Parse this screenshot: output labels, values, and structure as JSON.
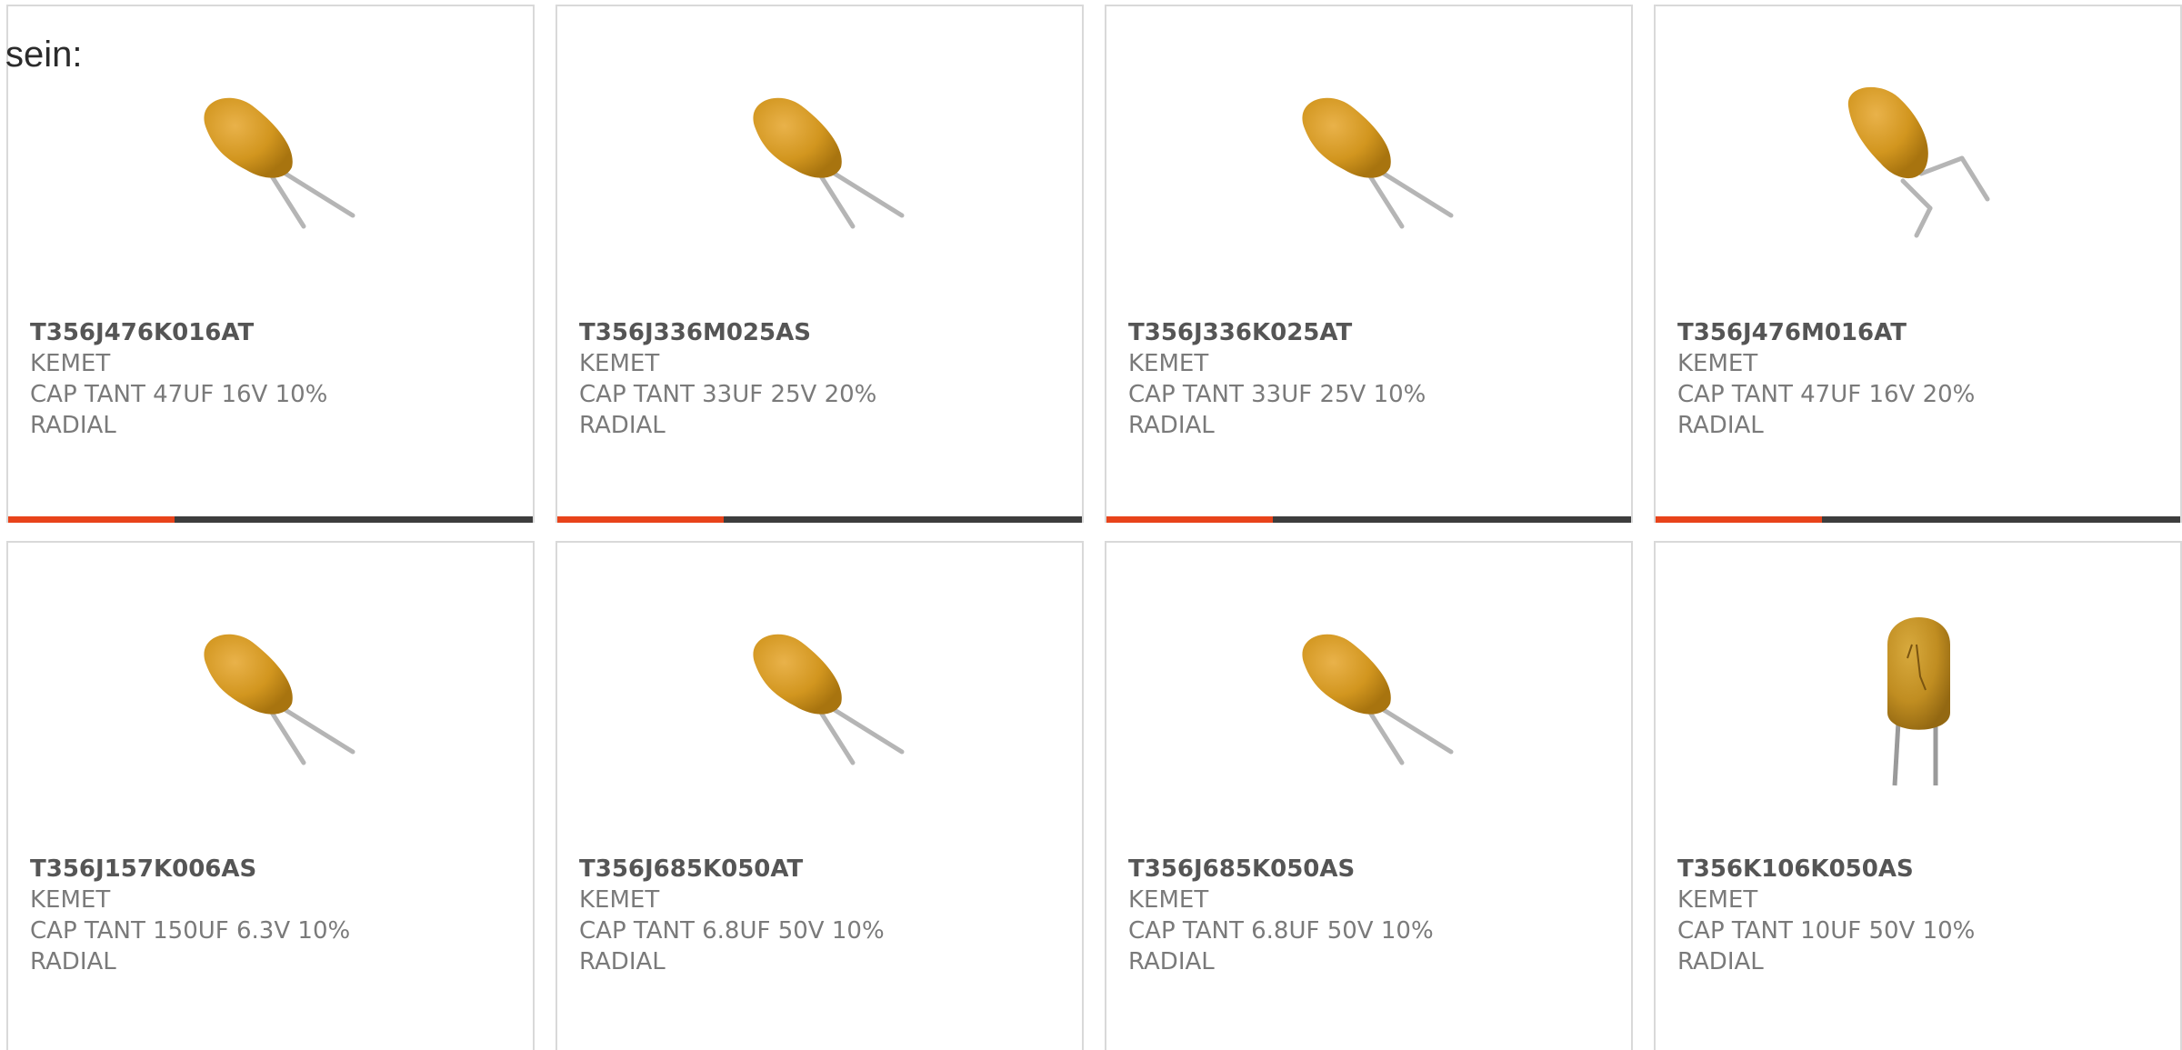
{
  "lead_text": "sein:",
  "accent_color": "#e8431a",
  "bar_color": "#3d3d3d",
  "products": [
    {
      "part": "T356J476K016AT",
      "maker": "KEMET",
      "desc1": "CAP TANT 47UF 16V 10%",
      "desc2": "RADIAL",
      "image": "radial-tantalum-capacitor-tilted"
    },
    {
      "part": "T356J336M025AS",
      "maker": "KEMET",
      "desc1": "CAP TANT 33UF 25V 20%",
      "desc2": "RADIAL",
      "image": "radial-tantalum-capacitor-tilted"
    },
    {
      "part": "T356J336K025AT",
      "maker": "KEMET",
      "desc1": "CAP TANT 33UF 25V 10%",
      "desc2": "RADIAL",
      "image": "radial-tantalum-capacitor-tilted"
    },
    {
      "part": "T356J476M016AT",
      "maker": "KEMET",
      "desc1": "CAP TANT 47UF 16V 20%",
      "desc2": "RADIAL",
      "image": "radial-tantalum-capacitor-angled"
    },
    {
      "part": "T356J157K006AS",
      "maker": "KEMET",
      "desc1": "CAP TANT 150UF 6.3V 10%",
      "desc2": "RADIAL",
      "image": "radial-tantalum-capacitor-tilted"
    },
    {
      "part": "T356J685K050AT",
      "maker": "KEMET",
      "desc1": "CAP TANT 6.8UF 50V 10%",
      "desc2": "RADIAL",
      "image": "radial-tantalum-capacitor-tilted"
    },
    {
      "part": "T356J685K050AS",
      "maker": "KEMET",
      "desc1": "CAP TANT 6.8UF 50V 10%",
      "desc2": "RADIAL",
      "image": "radial-tantalum-capacitor-tilted"
    },
    {
      "part": "T356K106K050AS",
      "maker": "KEMET",
      "desc1": "CAP TANT 10UF 50V 10%",
      "desc2": "RADIAL",
      "image": "radial-tantalum-capacitor-upright"
    }
  ]
}
